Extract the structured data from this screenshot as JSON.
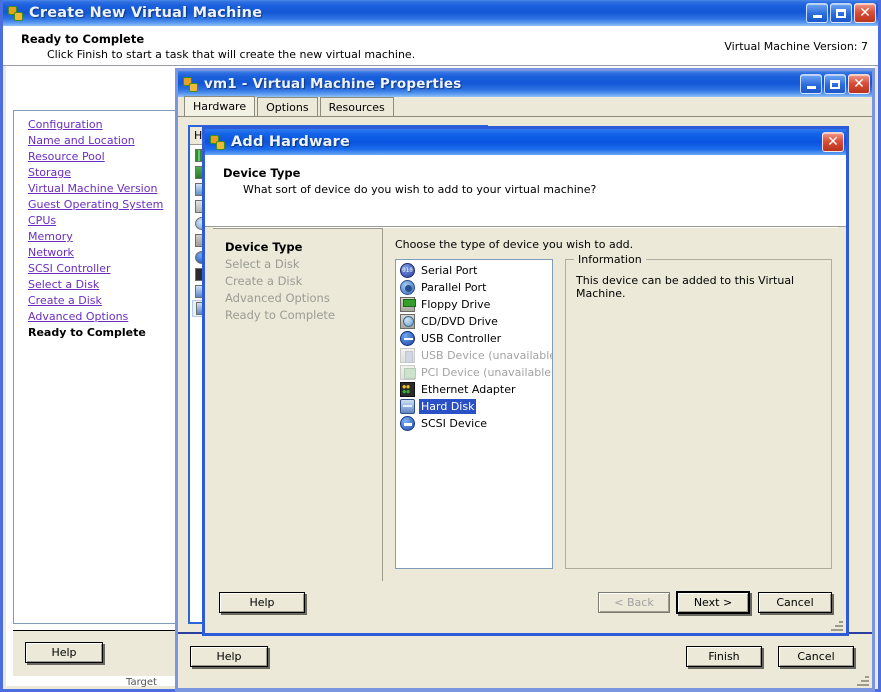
{
  "main_window": {
    "title": "Create New Virtual Machine",
    "icon": "vm-icon",
    "buttons": {
      "minimize": "_",
      "maximize": "□",
      "close": "✕"
    },
    "header": {
      "title": "Ready to Complete",
      "subtitle": "Click Finish to start a task that will create the new virtual machine.",
      "right_label": "Virtual Machine Version: 7"
    },
    "nav_items": [
      {
        "label": "Configuration",
        "current": false
      },
      {
        "label": "Name and Location",
        "current": false
      },
      {
        "label": "Resource Pool",
        "current": false
      },
      {
        "label": "Storage",
        "current": false
      },
      {
        "label": "Virtual Machine Version",
        "current": false
      },
      {
        "label": "Guest Operating System",
        "current": false
      },
      {
        "label": "CPUs",
        "current": false
      },
      {
        "label": "Memory",
        "current": false
      },
      {
        "label": "Network",
        "current": false
      },
      {
        "label": "SCSI Controller",
        "current": false
      },
      {
        "label": "Select a Disk",
        "current": false
      },
      {
        "label": "Create a Disk",
        "current": false
      },
      {
        "label": "Advanced Options",
        "current": false
      },
      {
        "label": "Ready to Complete",
        "current": true
      }
    ],
    "help_label": "Help",
    "partial_bottom_text": "Target"
  },
  "prop_window": {
    "title": "vm1 - Virtual Machine Properties",
    "buttons": {
      "minimize": "_",
      "maximize": "□",
      "close": "✕"
    },
    "tabs": [
      {
        "label": "Hardware",
        "active": true
      },
      {
        "label": "Options",
        "active": false
      },
      {
        "label": "Resources",
        "active": false
      }
    ],
    "hardware_column_header": "Ha",
    "hardware_rows": [
      {
        "icon": "memory-icon"
      },
      {
        "icon": "cpu-icon"
      },
      {
        "icon": "video-card-icon"
      },
      {
        "icon": "vmci-device-icon"
      },
      {
        "icon": "cd-dvd-drive-icon"
      },
      {
        "icon": "floppy-drive-icon"
      },
      {
        "icon": "usb-controller-icon"
      },
      {
        "icon": "network-adapter-icon"
      },
      {
        "icon": "hard-disk-icon"
      },
      {
        "icon": "hard-disk-icon"
      }
    ],
    "footer": {
      "help_label": "Help",
      "finish_label": "Finish",
      "cancel_label": "Cancel"
    }
  },
  "add_hardware_dialog": {
    "title": "Add Hardware",
    "close_button": "✕",
    "header": {
      "title": "Device Type",
      "subtitle": "What sort of device do you wish to add to your virtual machine?"
    },
    "steps": [
      {
        "label": "Device Type",
        "active": true
      },
      {
        "label": "Select a Disk",
        "active": false
      },
      {
        "label": "Create a Disk",
        "active": false
      },
      {
        "label": "Advanced Options",
        "active": false
      },
      {
        "label": "Ready to Complete",
        "active": false
      }
    ],
    "choose_label": "Choose the type of device you wish to add.",
    "devices": [
      {
        "label": "Serial Port",
        "icon": "serial-port-icon",
        "state": "normal"
      },
      {
        "label": "Parallel Port",
        "icon": "parallel-port-icon",
        "state": "normal"
      },
      {
        "label": "Floppy Drive",
        "icon": "floppy-drive-icon",
        "state": "normal"
      },
      {
        "label": "CD/DVD Drive",
        "icon": "cd-dvd-drive-icon",
        "state": "normal"
      },
      {
        "label": "USB Controller",
        "icon": "usb-controller-icon",
        "state": "normal"
      },
      {
        "label": "USB Device (unavailable)",
        "icon": "usb-device-icon",
        "state": "disabled"
      },
      {
        "label": "PCI Device (unavailable)",
        "icon": "pci-device-icon",
        "state": "disabled"
      },
      {
        "label": "Ethernet Adapter",
        "icon": "ethernet-adapter-icon",
        "state": "normal"
      },
      {
        "label": "Hard Disk",
        "icon": "hard-disk-icon",
        "state": "selected"
      },
      {
        "label": "SCSI Device",
        "icon": "scsi-device-icon",
        "state": "normal"
      }
    ],
    "information": {
      "legend": "Information",
      "text": "This device can be added to this Virtual Machine."
    },
    "footer": {
      "help_label": "Help",
      "back_label": "< Back",
      "next_label": "Next >",
      "cancel_label": "Cancel"
    }
  },
  "colors": {
    "title_blue": "#1457d6",
    "dialog_blue": "#0a54e0",
    "window_face": "#ece9d8",
    "link_purple": "#6a2fc0",
    "selection_blue": "#2a50c8",
    "close_red": "#d9503a"
  }
}
